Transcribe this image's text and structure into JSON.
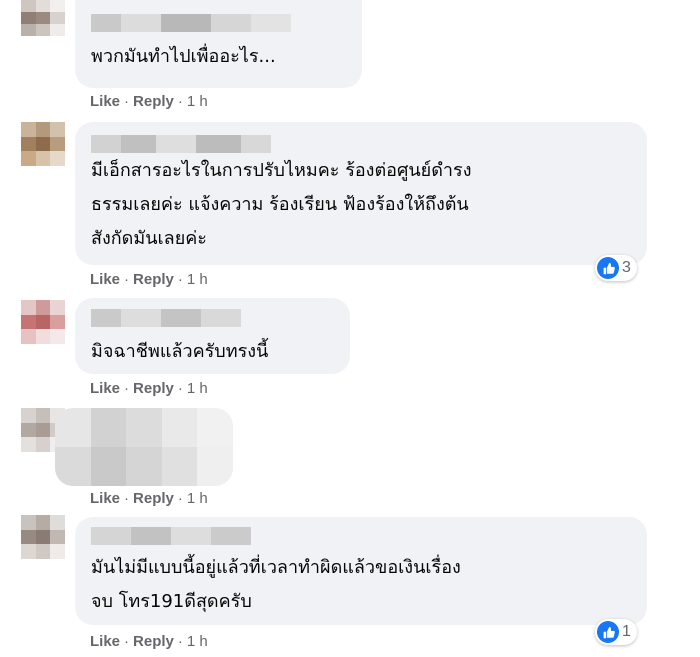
{
  "comments": [
    {
      "text_lines": [
        "พวกมันทำไปเพื่ออะไร..."
      ],
      "actions": {
        "like": "Like",
        "reply": "Reply",
        "time": "1 h"
      }
    },
    {
      "text_lines": [
        "มีเอ็กสารอะไรในการปรับไหมคะ ร้องต่อศูนย์ดำรง",
        "ธรรมเลยค่ะ แจ้งความ ร้องเรียน ฟ้องร้องให้ถึงต้น",
        "สังกัดมันเลยค่ะ"
      ],
      "actions": {
        "like": "Like",
        "reply": "Reply",
        "time": "1 h"
      },
      "reaction": {
        "icon": "like-icon",
        "count": "3"
      }
    },
    {
      "text_lines": [
        "มิจฉาชีพแล้วครับทรงนี้"
      ],
      "actions": {
        "like": "Like",
        "reply": "Reply",
        "time": "1 h"
      }
    },
    {
      "text_lines": [],
      "actions": {
        "like": "Like",
        "reply": "Reply",
        "time": "1 h"
      }
    },
    {
      "text_lines": [
        "มันไม่มีแบบนี้อยู่แล้วที่เวลาทำผิดแล้วขอเงินเรื่อง",
        "จบ โทร191ดีสุดครับ"
      ],
      "actions": {
        "like": "Like",
        "reply": "Reply",
        "time": "1 h"
      },
      "reaction": {
        "icon": "like-icon",
        "count": "1"
      }
    }
  ],
  "colors": {
    "bubble": "#f0f2f5",
    "action_text": "#65676b",
    "like_blue": "#1877f2"
  }
}
